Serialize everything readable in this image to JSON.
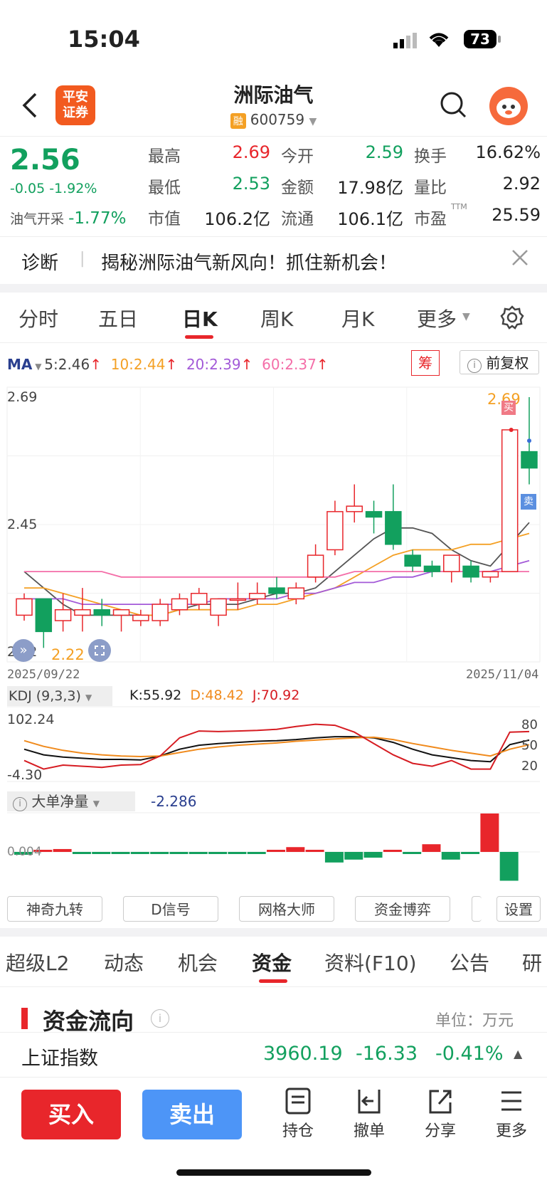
{
  "status": {
    "time": "15:04",
    "battery": "73"
  },
  "header": {
    "broker_logo": "平安\n证券",
    "stock_name": "洲际油气",
    "rong_badge": "融",
    "stock_code": "600759"
  },
  "quote": {
    "price": "2.56",
    "change": "-0.05 -1.92%",
    "sector_label": "油气开采",
    "sector_change": "-1.77%",
    "rows": [
      [
        {
          "l": "最高",
          "v": "2.69",
          "c": "red"
        },
        {
          "l": "今开",
          "v": "2.59",
          "c": "green"
        },
        {
          "l": "换手",
          "v": "16.62%",
          "c": ""
        }
      ],
      [
        {
          "l": "最低",
          "v": "2.53",
          "c": "green"
        },
        {
          "l": "金额",
          "v": "17.98亿",
          "c": ""
        },
        {
          "l": "量比",
          "v": "2.92",
          "c": ""
        }
      ],
      [
        {
          "l": "市值",
          "v": "106.2亿",
          "c": ""
        },
        {
          "l": "流通",
          "v": "106.1亿",
          "c": ""
        },
        {
          "l": "市盈",
          "v": "25.59",
          "c": "",
          "sup": "TTM"
        }
      ]
    ]
  },
  "banner": {
    "tag": "诊断",
    "text": "揭秘洲际油气新风向！抓住新机会！"
  },
  "period_tabs": {
    "items": [
      "分时",
      "五日",
      "日K",
      "周K",
      "月K",
      "更多"
    ],
    "active": 2
  },
  "ma": {
    "label": "MA",
    "ma5": "5:2.46",
    "ma10": "10:2.44",
    "ma20": "20:2.39",
    "ma60": "60:2.37",
    "chip_btn": "筹",
    "fq_btn": "前复权"
  },
  "kchart": {
    "hi_label": "2.69",
    "mid_label": "2.45",
    "lo_label": "2.22",
    "lo_marker": "2.22",
    "hi_marker": "2.69",
    "buy_tag": "买",
    "sell_tag": "卖",
    "date_start": "2025/09/22",
    "date_end": "2025/11/04"
  },
  "kdj": {
    "label": "KDJ (9,3,3)",
    "k": "K:55.92",
    "d": "D:48.42",
    "j": "J:70.92",
    "top": "102.24",
    "bottom": "-4.30",
    "l80": "80",
    "l50": "50",
    "l20": "20"
  },
  "flow": {
    "label": "大单净量",
    "value": "-2.286",
    "zero": "0.004"
  },
  "tools": [
    "神奇九转",
    "D信号",
    "网格大师",
    "资金博弈"
  ],
  "settings_btn": "设置",
  "section_tabs": {
    "items": [
      "超级L2",
      "动态",
      "机会",
      "资金",
      "资料(F10)",
      "公告",
      "研"
    ],
    "active": 3
  },
  "fund": {
    "title": "资金流向",
    "unit": "单位：万元"
  },
  "index_bar": {
    "name": "上证指数",
    "value": "3960.19",
    "change": "-16.33",
    "pct": "-0.41%"
  },
  "bottom": {
    "buy": "买入",
    "sell": "卖出",
    "t1": "持仓",
    "t2": "撤单",
    "t3": "分享",
    "t4": "更多"
  },
  "chart_data": {
    "type": "candlestick",
    "title": "",
    "x_range": [
      "2025/09/22",
      "2025/11/04"
    ],
    "y_labels": [
      "2.69",
      "2.45",
      "2.22"
    ],
    "candles": [
      {
        "o": 2.29,
        "c": 2.32,
        "h": 2.33,
        "l": 2.28
      },
      {
        "o": 2.32,
        "c": 2.26,
        "h": 2.32,
        "l": 2.23
      },
      {
        "o": 2.28,
        "c": 2.3,
        "h": 2.33,
        "l": 2.26
      },
      {
        "o": 2.29,
        "c": 2.3,
        "h": 2.34,
        "l": 2.26
      },
      {
        "o": 2.3,
        "c": 2.29,
        "h": 2.32,
        "l": 2.27
      },
      {
        "o": 2.29,
        "c": 2.3,
        "h": 2.3,
        "l": 2.26
      },
      {
        "o": 2.28,
        "c": 2.29,
        "h": 2.3,
        "l": 2.27
      },
      {
        "o": 2.28,
        "c": 2.31,
        "h": 2.32,
        "l": 2.27
      },
      {
        "o": 2.3,
        "c": 2.32,
        "h": 2.33,
        "l": 2.29
      },
      {
        "o": 2.31,
        "c": 2.33,
        "h": 2.34,
        "l": 2.3
      },
      {
        "o": 2.29,
        "c": 2.32,
        "h": 2.32,
        "l": 2.27
      },
      {
        "o": 2.32,
        "c": 2.32,
        "h": 2.35,
        "l": 2.3
      },
      {
        "o": 2.32,
        "c": 2.33,
        "h": 2.35,
        "l": 2.31
      },
      {
        "o": 2.34,
        "c": 2.33,
        "h": 2.36,
        "l": 2.32
      },
      {
        "o": 2.32,
        "c": 2.34,
        "h": 2.35,
        "l": 2.31
      },
      {
        "o": 2.36,
        "c": 2.4,
        "h": 2.42,
        "l": 2.35
      },
      {
        "o": 2.41,
        "c": 2.48,
        "h": 2.5,
        "l": 2.4
      },
      {
        "o": 2.48,
        "c": 2.49,
        "h": 2.53,
        "l": 2.46
      },
      {
        "o": 2.48,
        "c": 2.47,
        "h": 2.5,
        "l": 2.44
      },
      {
        "o": 2.48,
        "c": 2.42,
        "h": 2.53,
        "l": 2.41
      },
      {
        "o": 2.4,
        "c": 2.38,
        "h": 2.41,
        "l": 2.37
      },
      {
        "o": 2.38,
        "c": 2.37,
        "h": 2.39,
        "l": 2.36
      },
      {
        "o": 2.37,
        "c": 2.4,
        "h": 2.4,
        "l": 2.35
      },
      {
        "o": 2.38,
        "c": 2.36,
        "h": 2.39,
        "l": 2.35
      },
      {
        "o": 2.36,
        "c": 2.37,
        "h": 2.37,
        "l": 2.35
      },
      {
        "o": 2.37,
        "c": 2.63,
        "h": 2.63,
        "l": 2.37
      },
      {
        "o": 2.59,
        "c": 2.56,
        "h": 2.69,
        "l": 2.53
      }
    ],
    "ma_series": [
      {
        "name": "MA5",
        "color": "#555555",
        "values": [
          2.37,
          2.34,
          2.31,
          2.29,
          2.29,
          2.29,
          2.29,
          2.29,
          2.3,
          2.31,
          2.31,
          2.31,
          2.32,
          2.33,
          2.33,
          2.34,
          2.37,
          2.4,
          2.43,
          2.45,
          2.45,
          2.44,
          2.41,
          2.39,
          2.38,
          2.42,
          2.46
        ]
      },
      {
        "name": "MA10",
        "color": "#f4a024",
        "values": [
          2.34,
          2.34,
          2.33,
          2.32,
          2.31,
          2.3,
          2.29,
          2.29,
          2.3,
          2.3,
          2.3,
          2.3,
          2.31,
          2.31,
          2.32,
          2.33,
          2.34,
          2.36,
          2.38,
          2.4,
          2.41,
          2.41,
          2.41,
          2.42,
          2.42,
          2.43,
          2.44
        ]
      },
      {
        "name": "MA20",
        "color": "#a35ad8",
        "values": [
          2.32,
          2.32,
          2.32,
          2.31,
          2.31,
          2.31,
          2.31,
          2.31,
          2.31,
          2.31,
          2.32,
          2.32,
          2.32,
          2.32,
          2.33,
          2.33,
          2.34,
          2.35,
          2.35,
          2.36,
          2.36,
          2.37,
          2.37,
          2.37,
          2.37,
          2.38,
          2.39
        ]
      },
      {
        "name": "MA60",
        "color": "#f46ea8",
        "values": [
          2.37,
          2.37,
          2.37,
          2.37,
          2.37,
          2.36,
          2.36,
          2.36,
          2.36,
          2.36,
          2.36,
          2.36,
          2.36,
          2.36,
          2.36,
          2.36,
          2.36,
          2.37,
          2.37,
          2.37,
          2.37,
          2.37,
          2.37,
          2.37,
          2.37,
          2.37,
          2.37
        ]
      }
    ],
    "kdj_series": [
      {
        "name": "K",
        "color": "#111111",
        "values": [
          40,
          30,
          26,
          24,
          22,
          22,
          21,
          28,
          40,
          47,
          50,
          52,
          54,
          55,
          57,
          60,
          62,
          62,
          60,
          52,
          40,
          30,
          25,
          20,
          18,
          48,
          56
        ]
      },
      {
        "name": "D",
        "color": "#f08a1c",
        "values": [
          55,
          45,
          38,
          33,
          30,
          28,
          27,
          28,
          34,
          40,
          44,
          47,
          49,
          51,
          54,
          56,
          58,
          60,
          61,
          57,
          50,
          44,
          38,
          33,
          28,
          40,
          48
        ]
      },
      {
        "name": "J",
        "color": "#d61c22",
        "values": [
          20,
          5,
          12,
          10,
          8,
          12,
          13,
          28,
          60,
          72,
          71,
          72,
          73,
          75,
          80,
          84,
          82,
          70,
          50,
          30,
          15,
          10,
          20,
          5,
          5,
          70,
          71
        ]
      }
    ],
    "flow_bars": [
      -0.3,
      0.2,
      0.3,
      -0.1,
      -0.1,
      -0.1,
      -0.1,
      -0.1,
      -0.1,
      -0.1,
      -0.1,
      -0.1,
      -0.1,
      0.1,
      0.5,
      0.1,
      -1.1,
      -0.8,
      -0.6,
      0.2,
      -0.1,
      0.8,
      -0.8,
      -0.2,
      4.0,
      -3.0
    ]
  }
}
